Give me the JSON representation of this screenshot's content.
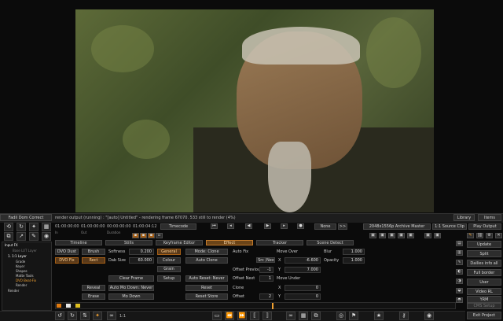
{
  "window": {
    "panel_title": "Fadil Dom Correct"
  },
  "status": {
    "message": "render output (running) : \"[auto] Untitled\" - rendering frame 67070. 533 still to render (4%)"
  },
  "top_right": {
    "library": "Library",
    "items": "Items"
  },
  "timecodes": {
    "tc1": "01:00:00:00",
    "tc2": "01:00:00:00",
    "tc3": "00:00:00:00",
    "tc4": "01:00:04:12",
    "in_label": "In",
    "out_label": "Out",
    "duration_label": "Duration",
    "timecode_button": "Timecode"
  },
  "transport": {
    "none": "None",
    "skip": ">>",
    "master": "2048x1556p Archive Master",
    "source_clip": "1:1 Source Clip",
    "play_output": "Play Output"
  },
  "sidebar": {
    "items": [
      "Input FX",
      "Base LUT Layer",
      "1. 1:1 Layer",
      "Grade",
      "Keyer",
      "Shapes",
      "Matte Tools",
      "DVO Beat-Fix",
      "Render",
      "Render"
    ]
  },
  "tabs": {
    "timeline": "Timeline",
    "stills": "Stills",
    "keyframe": "Keyframe Editor",
    "effect": "Effect",
    "tracker": "Tracker",
    "scene_detect": "Scene Detect"
  },
  "left_col": {
    "dvo_dust": "DVO Dust",
    "dvo_fix": "DVO Fix",
    "brush": "Brush",
    "rect": "Rect",
    "reveal": "Reveal",
    "erase": "Erase"
  },
  "params": {
    "softness_label": "Softness",
    "softness": "0.200",
    "dab_size_label": "Dab Size",
    "dab_size": "60.000",
    "clear_frame": "Clear Frame",
    "auto_mo_down": "Auto Mo Down: Never",
    "mo_down": "Mo Down"
  },
  "mid_col": {
    "general": "General",
    "colour": "Colour",
    "grain": "Grain",
    "setup": "Setup"
  },
  "clone": {
    "mode_label": "Mode: Clone",
    "auto_fix": "Auto Fix",
    "auto_clone": "Auto Clone",
    "auto_reset": "Auto Reset: Never",
    "reset": "Reset",
    "reset_store": "Reset Store",
    "src": "Src",
    "next": "Next",
    "offset_previous": "Offset Previous",
    "offset_prev_val": "-1",
    "offset_next": "Offset Next",
    "offset_next_val": "1",
    "clone": "Clone",
    "offset": "Offset",
    "offset_val": "2"
  },
  "move": {
    "move_over": "Move Over",
    "x_label": "X",
    "x1": "-6.600",
    "y_label": "Y",
    "y1": "7.000",
    "move_under": "Move Under",
    "x2": "0",
    "y2": "0"
  },
  "blur": {
    "blur_label": "Blur",
    "blur_val": "1.000",
    "opacity_label": "Opacity",
    "opacity_val": "1.000"
  },
  "right_panel": {
    "update": "Update",
    "split": "Split",
    "dailies": "Dailies info all",
    "full_border": "Full border",
    "user": "User",
    "video_rl": "Video RL",
    "yrm": "YRM",
    "cms_setup": "CMS Setup",
    "exit_project": "Exit Project"
  },
  "zoom": "1:1"
}
